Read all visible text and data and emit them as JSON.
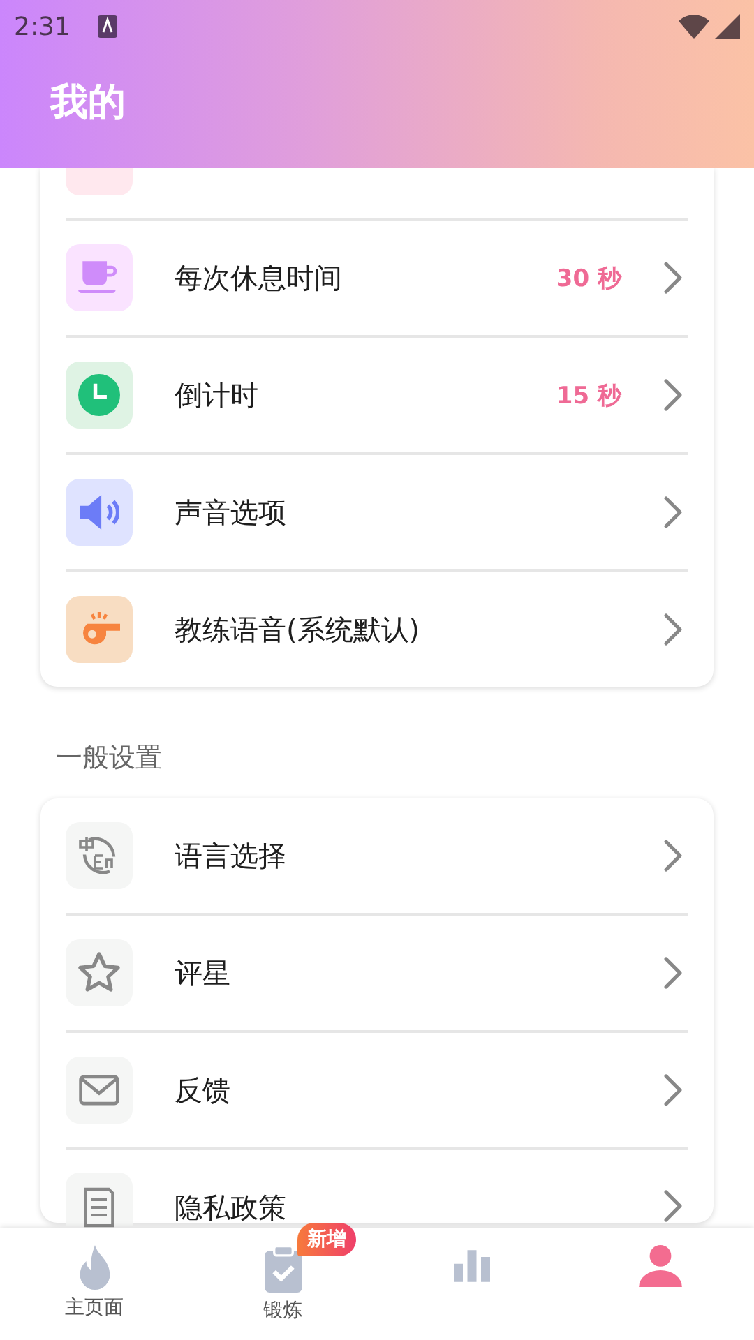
{
  "status_bar": {
    "time": "2:31"
  },
  "header": {
    "title": "我的"
  },
  "workout_settings": {
    "items": [
      {
        "label": "每次休息时间",
        "value": "30 秒"
      },
      {
        "label": "倒计时",
        "value": "15 秒"
      },
      {
        "label": "声音选项"
      },
      {
        "label": "教练语音(系统默认)"
      }
    ]
  },
  "general_settings": {
    "title": "一般设置",
    "items": [
      {
        "label": "语言选择"
      },
      {
        "label": "评星"
      },
      {
        "label": "反馈"
      },
      {
        "label": "隐私政策"
      }
    ]
  },
  "bottom_nav": {
    "tabs": [
      {
        "label": "主页面",
        "selected": false
      },
      {
        "label": "锻炼",
        "selected": false,
        "badge": "新增"
      },
      {
        "selected": false
      },
      {
        "selected": true
      }
    ]
  }
}
